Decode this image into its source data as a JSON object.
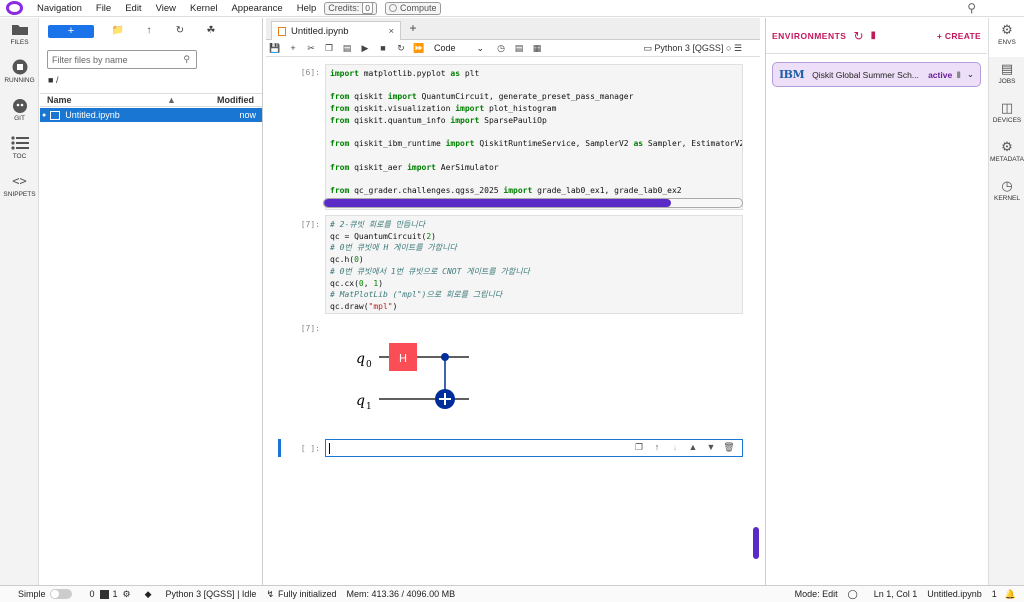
{
  "menubar": {
    "items": [
      "Navigation",
      "File",
      "Edit",
      "View",
      "Kernel",
      "Appearance",
      "Help"
    ],
    "credits_label": "Credits:",
    "credits_value": "0",
    "compute_label": "Compute"
  },
  "leftbar": {
    "items": [
      {
        "label": "FILES",
        "icon": "folder-icon"
      },
      {
        "label": "RUNNING",
        "icon": "stop-circle-icon"
      },
      {
        "label": "GIT",
        "icon": "git-icon"
      },
      {
        "label": "TOC",
        "icon": "list-icon"
      },
      {
        "label": "SNIPPETS",
        "icon": "code-brackets-icon"
      }
    ]
  },
  "filebrowser": {
    "new_label": "+",
    "filter_placeholder": "Filter files by name",
    "path": "/",
    "col_name": "Name",
    "col_modified": "Modified",
    "files": [
      {
        "name": "Untitled.ipynb",
        "modified": "now"
      }
    ]
  },
  "notebook": {
    "tab_title": "Untitled.ipynb",
    "cell_type": "Code",
    "kernel": "Python 3 [QGSS]",
    "cells": [
      {
        "prompt": "[6]:"
      },
      {
        "prompt": "[7]:"
      },
      {
        "prompt": "[7]:"
      },
      {
        "prompt": "[ ]:"
      }
    ],
    "progress_fraction": 0.83,
    "circuit": {
      "q0": "q",
      "q0sub": "0",
      "q1": "q",
      "q1sub": "1",
      "gate": "H"
    }
  },
  "rightpanel": {
    "title": "ENVIRONMENTS",
    "create_label": "+ CREATE",
    "env_brand": "IBM",
    "env_name": "Qiskit Global Summer Sch...",
    "env_status": "active"
  },
  "rightbar": {
    "items": [
      {
        "label": "ENVS",
        "icon": "gear-icon"
      },
      {
        "label": "JOBS",
        "icon": "jobs-icon"
      },
      {
        "label": "DEVICES",
        "icon": "devices-icon"
      },
      {
        "label": "METADATA",
        "icon": "cogs-icon"
      },
      {
        "label": "KERNEL",
        "icon": "gauge-icon"
      }
    ]
  },
  "status": {
    "mode_simple": "Simple",
    "count_terminals": "0",
    "count_kernels": "1",
    "kernel_status": "Python 3 [QGSS] | Idle",
    "init_status": "Fully initialized",
    "memory": "Mem: 413.36 / 4096.00 MB",
    "mode": "Mode: Edit",
    "cursor": "Ln 1, Col 1",
    "filename": "Untitled.ipynb",
    "right_count": "1"
  },
  "colors": {
    "accent": "#1976d2",
    "progress": "#5b2bc8",
    "env": "#c2185b"
  }
}
